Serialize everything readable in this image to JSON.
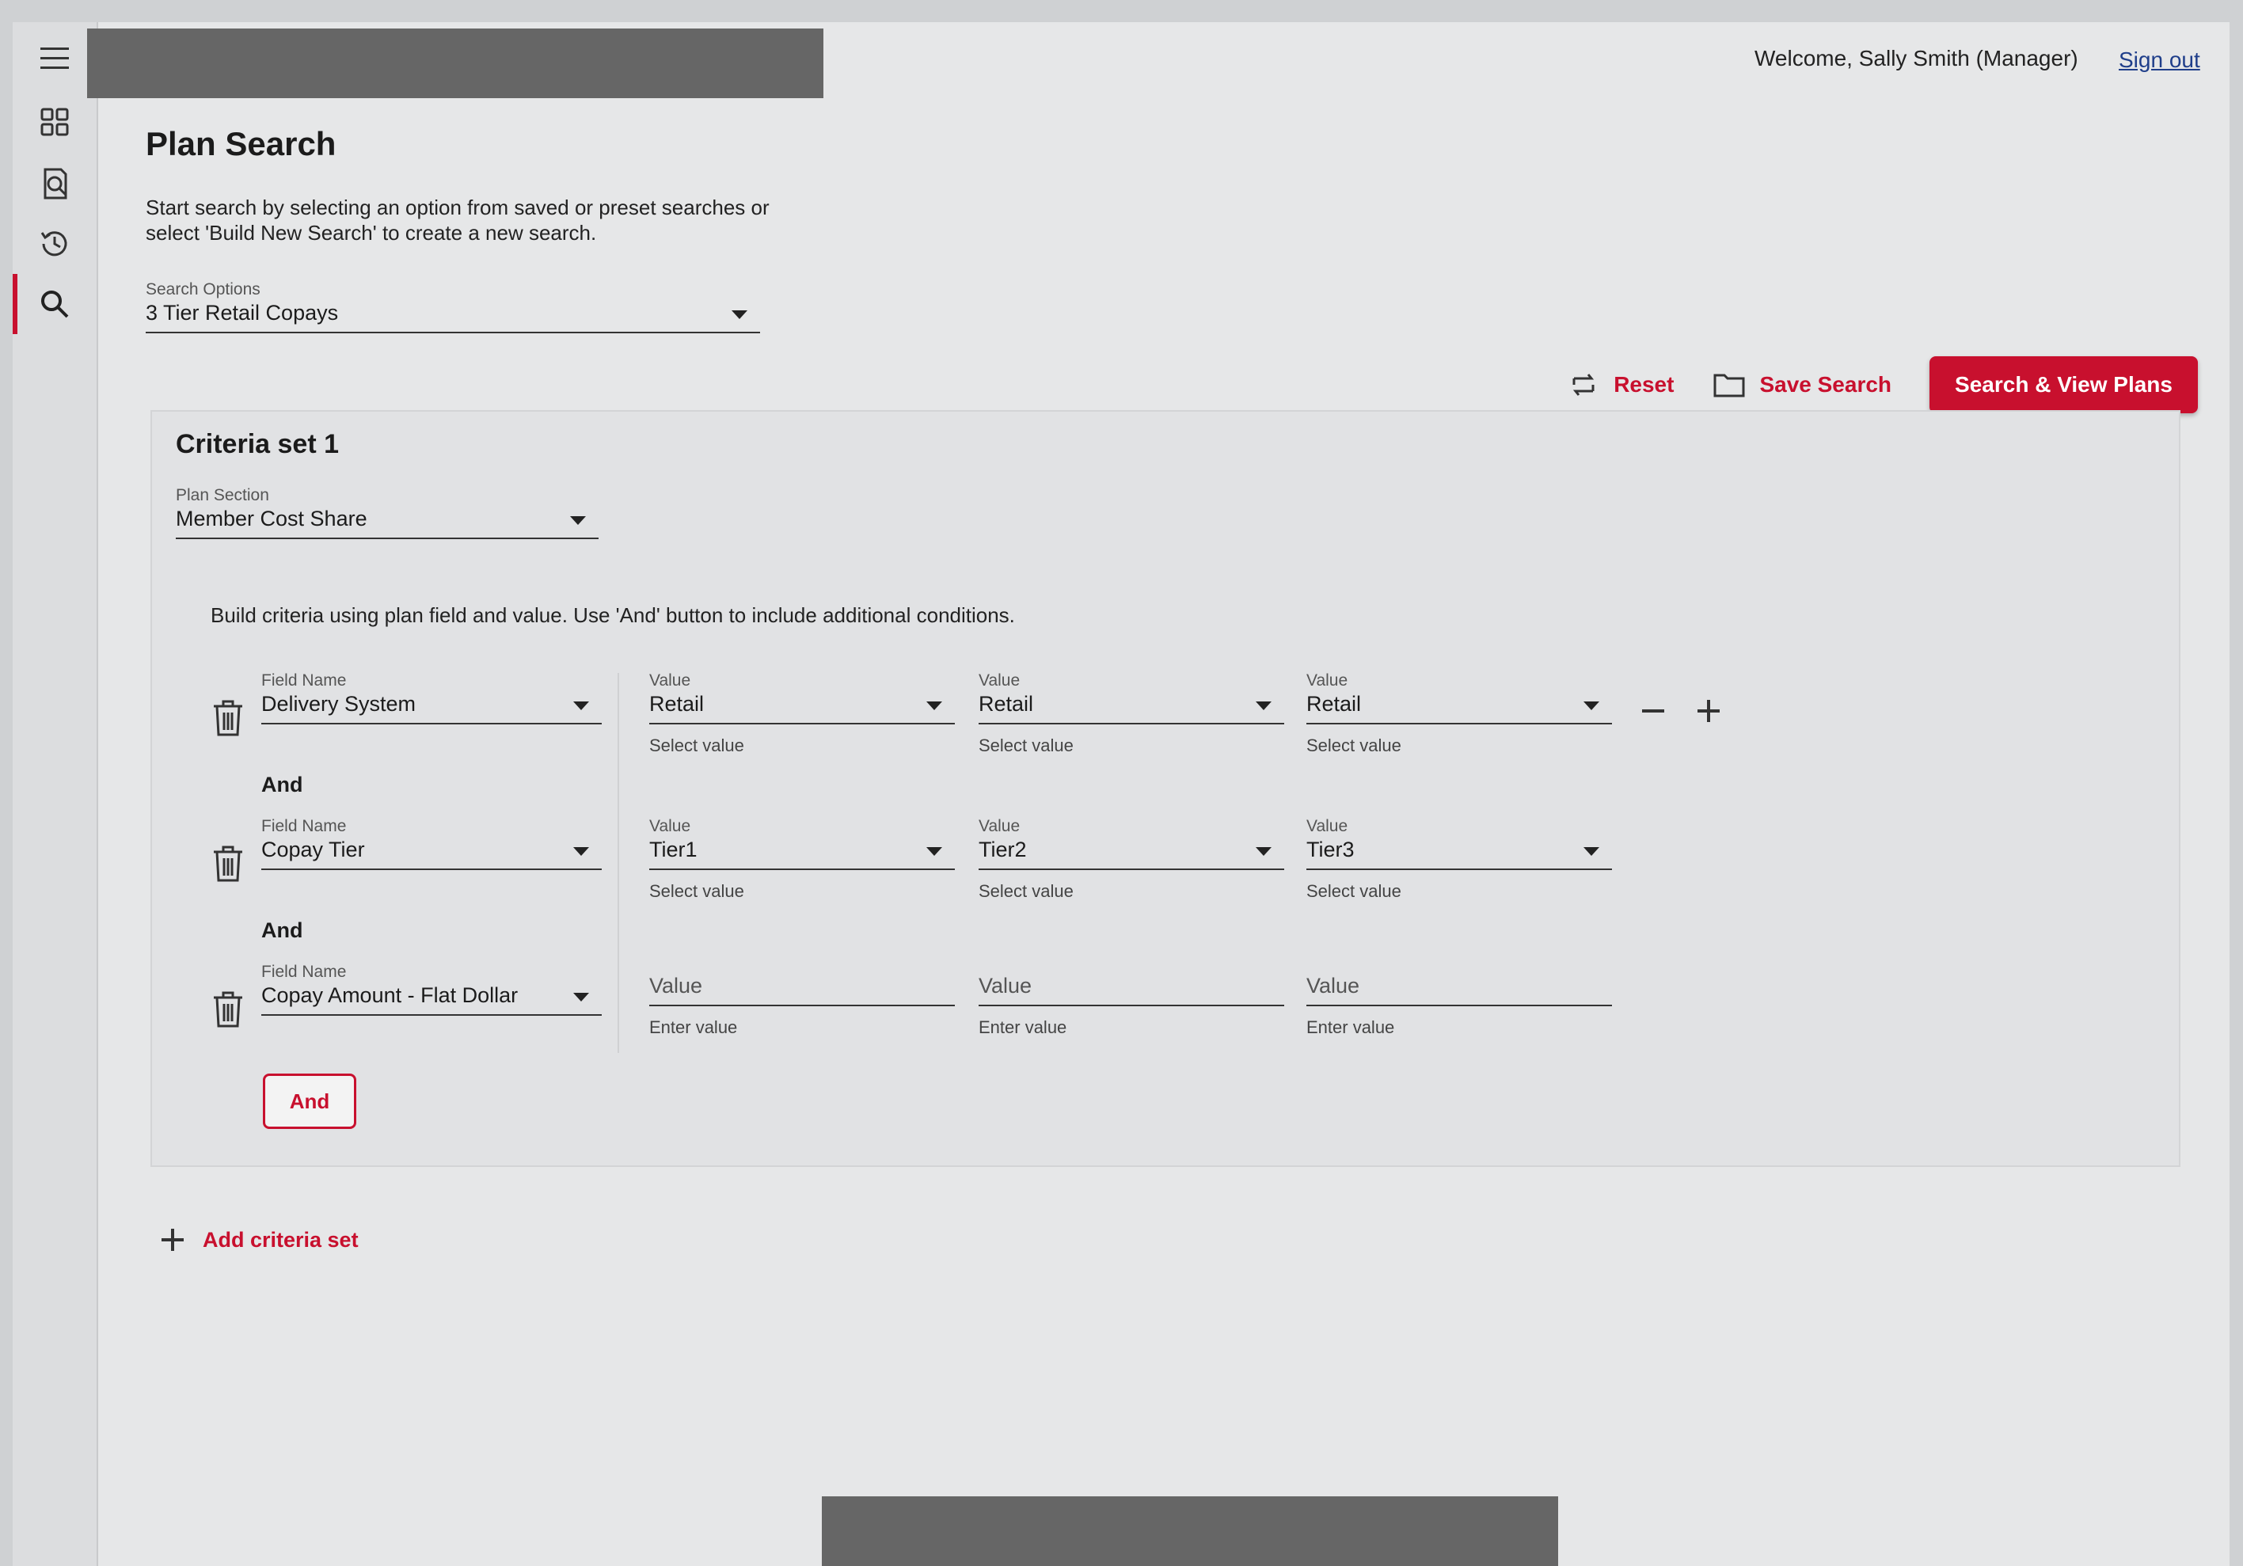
{
  "header": {
    "welcome": "Welcome, Sally Smith (Manager)",
    "signout": "Sign out"
  },
  "page": {
    "title": "Plan Search",
    "intro": "Start search by selecting an option from saved or preset searches or select 'Build New Search' to create a new search."
  },
  "search_options": {
    "label": "Search Options",
    "value": "3 Tier Retail Copays"
  },
  "actions": {
    "reset": "Reset",
    "save": "Save Search",
    "search": "Search & View Plans"
  },
  "criteria_set": {
    "title": "Criteria set 1",
    "plan_section_label": "Plan Section",
    "plan_section_value": "Member Cost Share",
    "hint": "Build criteria using plan field and value. Use 'And' button to include additional conditions.",
    "and_label": "And",
    "rows": [
      {
        "field_label": "Field Name",
        "field_value": "Delivery System",
        "values": [
          {
            "label": "Value",
            "value": "Retail",
            "helper": "Select value"
          },
          {
            "label": "Value",
            "value": "Retail",
            "helper": "Select value"
          },
          {
            "label": "Value",
            "value": "Retail",
            "helper": "Select value"
          }
        ]
      },
      {
        "field_label": "Field Name",
        "field_value": "Copay Tier",
        "values": [
          {
            "label": "Value",
            "value": "Tier1",
            "helper": "Select value"
          },
          {
            "label": "Value",
            "value": "Tier2",
            "helper": "Select value"
          },
          {
            "label": "Value",
            "value": "Tier3",
            "helper": "Select value"
          }
        ]
      },
      {
        "field_label": "Field Name",
        "field_value": "Copay Amount - Flat Dollar",
        "values": [
          {
            "placeholder": "Value",
            "helper": "Enter value"
          },
          {
            "placeholder": "Value",
            "helper": "Enter value"
          },
          {
            "placeholder": "Value",
            "helper": "Enter value"
          }
        ]
      }
    ],
    "and_button": "And"
  },
  "add_criteria": "Add criteria set",
  "icons": {
    "rail": [
      "menu-icon",
      "dashboard-icon",
      "document-search-icon",
      "history-icon",
      "search-icon"
    ],
    "trash": "trash-icon",
    "minus": "minus-icon",
    "plus": "plus-icon"
  },
  "colors": {
    "accent": "#c8102e",
    "link": "#1f3e8a"
  }
}
